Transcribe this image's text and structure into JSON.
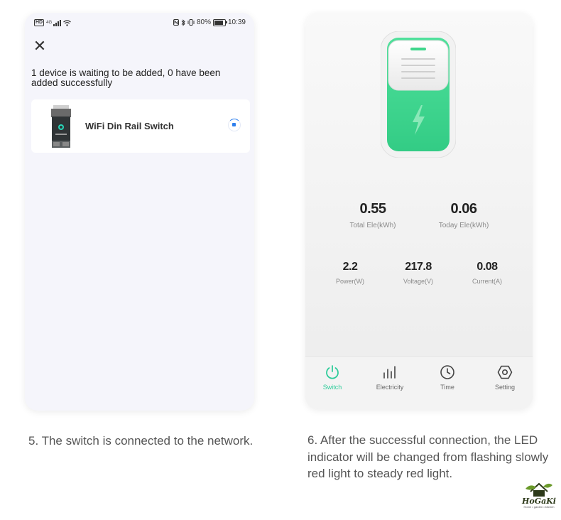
{
  "left_phone": {
    "status_bar": {
      "network": "4G",
      "battery": "80%",
      "time": "10:39"
    },
    "message": "1 device is waiting to be added, 0 have been added successfully",
    "device": {
      "name": "WiFi Din Rail Switch"
    }
  },
  "right_phone": {
    "stats_top": [
      {
        "value": "0.55",
        "label": "Total Ele(kWh)"
      },
      {
        "value": "0.06",
        "label": "Today Ele(kWh)"
      }
    ],
    "stats_bottom": [
      {
        "value": "2.2",
        "label": "Power(W)"
      },
      {
        "value": "217.8",
        "label": "Voltage(V)"
      },
      {
        "value": "0.08",
        "label": "Current(A)"
      }
    ],
    "tabs": [
      {
        "label": "Switch",
        "icon": "power-icon",
        "active": true
      },
      {
        "label": "Electricity",
        "icon": "bar-chart-icon",
        "active": false
      },
      {
        "label": "Time",
        "icon": "clock-icon",
        "active": false
      },
      {
        "label": "Setting",
        "icon": "gear-icon",
        "active": false
      }
    ]
  },
  "captions": {
    "left": "5. The switch is connected to the network.",
    "right": "6. After the successful connection, the LED indicator will be changed from flashing slowly red light to steady red light."
  },
  "logo": {
    "name": "HoGaKi",
    "tagline": "Home • garden • kitchen"
  },
  "colors": {
    "accent_green": "#2ecc9a",
    "device_green": "#3fd68b",
    "spinner_blue": "#2f80ed"
  }
}
